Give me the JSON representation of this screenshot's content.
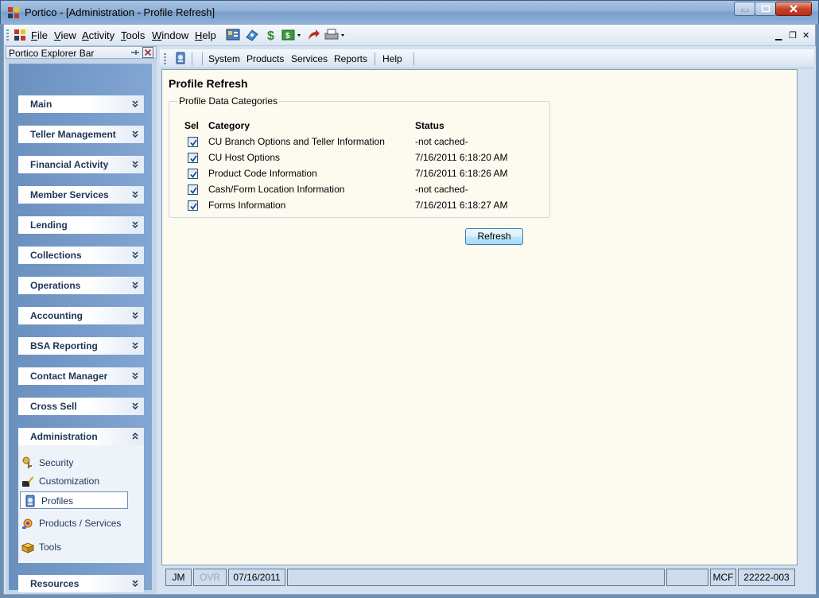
{
  "window": {
    "title": "Portico - [Administration - Profile Refresh]"
  },
  "menubar": {
    "items": [
      {
        "label": "File",
        "mnemonic": "F",
        "rest": "ile"
      },
      {
        "label": "View",
        "mnemonic": "V",
        "rest": "iew"
      },
      {
        "label": "Activity",
        "mnemonic": "A",
        "rest": "ctivity"
      },
      {
        "label": "Tools",
        "mnemonic": "T",
        "rest": "ools"
      },
      {
        "label": "Window",
        "mnemonic": "W",
        "rest": "indow"
      },
      {
        "label": "Help",
        "mnemonic": "H",
        "rest": "elp"
      }
    ],
    "toolbar_icons": [
      "account-icon",
      "teller-icon",
      "dollar-icon",
      "cash-dropdown-icon",
      "arrow-icon",
      "printer-dropdown-icon"
    ]
  },
  "explorer": {
    "title": "Portico Explorer Bar",
    "groups": [
      {
        "label": "Main"
      },
      {
        "label": "Teller Management"
      },
      {
        "label": "Financial Activity"
      },
      {
        "label": "Member Services"
      },
      {
        "label": "Lending"
      },
      {
        "label": "Collections"
      },
      {
        "label": "Operations"
      },
      {
        "label": "Accounting"
      },
      {
        "label": "BSA Reporting"
      },
      {
        "label": "Contact Manager"
      },
      {
        "label": "Cross Sell"
      },
      {
        "label": "Administration"
      },
      {
        "label": "Resources"
      }
    ],
    "admin_tasks": [
      {
        "label": "Security",
        "icon": "security-icon"
      },
      {
        "label": "Customization",
        "icon": "customization-icon"
      },
      {
        "label": "Profiles",
        "icon": "profiles-icon",
        "selected": true
      },
      {
        "label": "Products / Services",
        "icon": "products-services-icon"
      },
      {
        "label": "Tools",
        "icon": "tools-icon"
      }
    ]
  },
  "main_toolbar": {
    "items": [
      "System",
      "Products",
      "Services",
      "Reports",
      "Help"
    ]
  },
  "content": {
    "heading": "Profile Refresh",
    "fieldset_legend": "Profile Data Categories",
    "columns": {
      "sel": "Sel",
      "category": "Category",
      "status": "Status"
    },
    "rows": [
      {
        "checked": true,
        "category": "CU Branch Options and Teller Information",
        "status": "-not cached-"
      },
      {
        "checked": true,
        "category": "CU Host Options",
        "status": "7/16/2011 6:18:20 AM"
      },
      {
        "checked": true,
        "category": "Product Code Information",
        "status": "7/16/2011 6:18:26 AM"
      },
      {
        "checked": true,
        "category": "Cash/Form Location Information",
        "status": "-not cached-"
      },
      {
        "checked": true,
        "category": "Forms Information",
        "status": "7/16/2011 6:18:27 AM"
      }
    ],
    "refresh_label": "Refresh"
  },
  "statusbar": {
    "user": "JM",
    "ovr": "OVR",
    "date": "07/16/2011",
    "blank1": "",
    "blank2": "",
    "mode": "MCF",
    "account": "22222-003"
  },
  "colors": {
    "content_bg": "#fdfaf0",
    "explorer_panel": "#7a9dca",
    "group_label": "#1e3557"
  }
}
